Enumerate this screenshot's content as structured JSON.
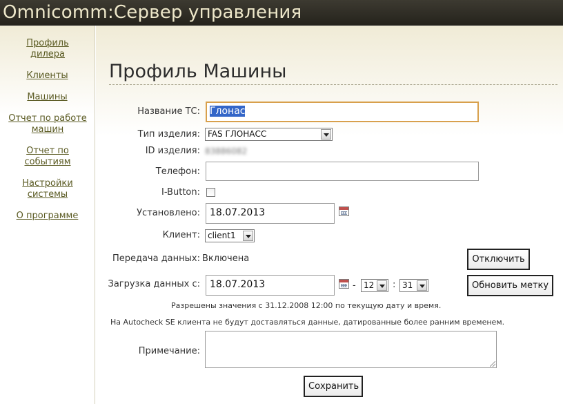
{
  "app": {
    "title": "Omnicomm:Сервер управления"
  },
  "sidebar": {
    "items": [
      {
        "label": "Профиль дилера"
      },
      {
        "label": "Клиенты"
      },
      {
        "label": "Машины"
      },
      {
        "label": "Отчет по работе машин"
      },
      {
        "label": "Отчет по событиям"
      },
      {
        "label": "Настройки системы"
      },
      {
        "label": "О программе"
      }
    ]
  },
  "page": {
    "title": "Профиль Машины"
  },
  "form": {
    "vehicle_name": {
      "label": "Название ТС:",
      "value": "Глонас"
    },
    "device_type": {
      "label": "Тип изделия:",
      "value": "FAS ГЛОНАСС"
    },
    "device_id": {
      "label": "ID изделия:",
      "value": "83886082"
    },
    "phone": {
      "label": "Телефон:",
      "value": ""
    },
    "ibutton": {
      "label": "I-Button:",
      "checked": false
    },
    "installed": {
      "label": "Установлено:",
      "value": "18.07.2013"
    },
    "client": {
      "label": "Клиент:",
      "value": "client1"
    },
    "data_transfer": {
      "label": "Передача данных:",
      "value": "Включена",
      "button_label": "Отключить"
    },
    "data_load": {
      "label": "Загрузка данных с:",
      "date": "18.07.2013",
      "dash": "-",
      "hour": "12",
      "colon": ":",
      "minute": "31",
      "button_label": "Обновить метку"
    },
    "hint1": "Разрешены значения с 31.12.2008 12:00 по текущую дату и время.",
    "hint2": "На Autocheck SE клиента не будут доставляться данные, датированные более ранним временем.",
    "note": {
      "label": "Примечание:",
      "value": ""
    },
    "save_label": "Сохранить"
  }
}
